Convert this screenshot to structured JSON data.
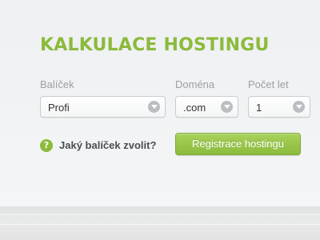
{
  "calculator": {
    "title": "KALKULACE HOSTINGU",
    "fields": {
      "package": {
        "label": "Balíček",
        "value": "Profi"
      },
      "domain": {
        "label": "Doména",
        "value": ".com"
      },
      "count": {
        "label": "Počet let",
        "value": "1"
      }
    },
    "help_link": "Jaký balíček zvolit?",
    "submit_label": "Registrace hostingu"
  },
  "colors": {
    "accent": "#8cba3c",
    "button_top": "#a9d25a",
    "button_bottom": "#8bbb3c",
    "label_gray": "#9aa0a4",
    "text_dark": "#4a4f53"
  },
  "icons": {
    "dropdown": "chevron-down-icon",
    "help": "question-icon"
  }
}
